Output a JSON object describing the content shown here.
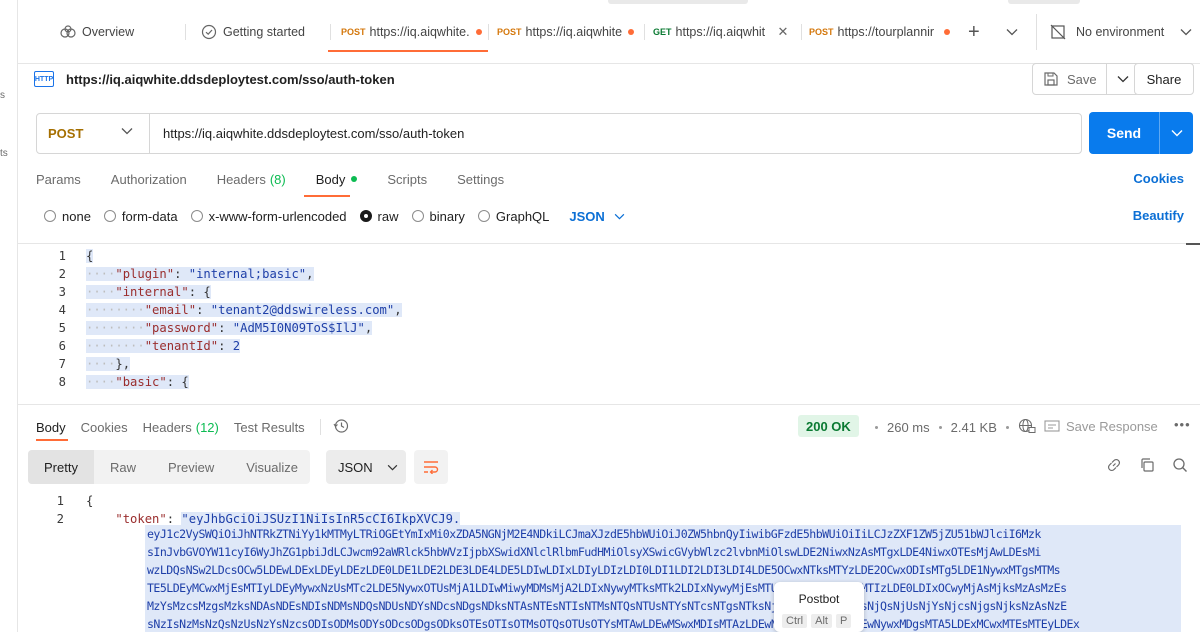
{
  "left_nav": {
    "items": [
      "s",
      "ts"
    ]
  },
  "tabs": [
    {
      "type": "home",
      "label": "Overview"
    },
    {
      "type": "home",
      "label": "Getting started"
    },
    {
      "type": "request",
      "method": "POST",
      "url": "https://iq.aiqwhite.",
      "unsaved": true,
      "method_color": "#d4770b"
    },
    {
      "type": "request",
      "method": "POST",
      "url": "https://iq.aiqwhite",
      "unsaved": true,
      "method_color": "#d4770b"
    },
    {
      "type": "request",
      "method": "GET",
      "url": "https://iq.aiqwhit",
      "unsaved": false,
      "method_color": "#0a7a32"
    },
    {
      "type": "request",
      "method": "POST",
      "url": "https://tourplannir",
      "unsaved": true,
      "method_color": "#d4770b"
    }
  ],
  "environment": "No environment",
  "request": {
    "title": "https://iq.aiqwhite.ddsdeploytest.com/sso/auth-token",
    "save_label": "Save",
    "share_label": "Share",
    "method": "POST",
    "url": "https://iq.aiqwhite.ddsdeploytest.com/sso/auth-token",
    "send_label": "Send",
    "subtabs": [
      {
        "label": "Params"
      },
      {
        "label": "Authorization"
      },
      {
        "label": "Headers",
        "count": "(8)"
      },
      {
        "label": "Body",
        "active": true
      },
      {
        "label": "Scripts"
      },
      {
        "label": "Settings"
      }
    ],
    "cookies_label": "Cookies",
    "body_modes": [
      "none",
      "form-data",
      "x-www-form-urlencoded",
      "raw",
      "binary",
      "GraphQL"
    ],
    "selected_mode": "raw",
    "format": "JSON",
    "beautify_label": "Beautify",
    "body_lines": [
      {
        "n": "1",
        "text": "{"
      },
      {
        "n": "2",
        "key": "\"plugin\"",
        "value": "\"internal;basic\"",
        "suffix": ","
      },
      {
        "n": "3",
        "key": "\"internal\"",
        "value": "{",
        "suffix": ""
      },
      {
        "n": "4",
        "key": "\"email\"",
        "value": "\"tenant2@ddswireless.com\"",
        "suffix": ","
      },
      {
        "n": "5",
        "key": "\"password\"",
        "value": "\"AdM5I0N09ToS$IlJ\"",
        "suffix": ","
      },
      {
        "n": "6",
        "key": "\"tenantId\"",
        "value": "2",
        "suffix": ""
      },
      {
        "n": "7",
        "text": "},"
      },
      {
        "n": "8",
        "key": "\"basic\"",
        "value": "{",
        "suffix": ""
      }
    ]
  },
  "response": {
    "tabs": [
      {
        "label": "Body",
        "active": true
      },
      {
        "label": "Cookies"
      },
      {
        "label": "Headers",
        "count": "(12)"
      },
      {
        "label": "Test Results"
      }
    ],
    "status": "200 OK",
    "time": "260 ms",
    "size": "2.41 KB",
    "save_response_label": "Save Response",
    "view_modes": [
      "Pretty",
      "Raw",
      "Preview",
      "Visualize"
    ],
    "format": "JSON",
    "line1": "{",
    "token_key": "\"token\"",
    "token_first": "\"eyJhbGciOiJSUzI1NiIsInR5cCI6IkpXVCJ9.",
    "token_lines": [
      "eyJ1c2VySWQiOiJhNTRkZTNiYy1kMTMyLTRiOGEtYmIxMi0xZDA5NGNjM2E4NDkiLCJmaXJzdE5hbWUiOiJ0ZW5hbnQyIiwibGFzdE5hbWUiOiIiLCJzZXF1ZW5jZU51bWJlciI6Mzk",
      "sInJvbGVOYW11cyI6WyJhZG1pbiJdLCJwcm92aWRlck5hbWVzIjpbXSwidXNlclRlbmFudHMiOlsyXSwicGVybWlzc2lvbnMiOlswLDE2NiwxNzAsMTgxLDE4NiwxOTEsMjAwLDEsMi",
      "wzLDQsNSw2LDcsOCw5LDEwLDExLDEyLDEzLDE0LDE1LDE2LDE3LDE4LDE5LDIwLDIxLDIyLDIzLDI0LDI1LDI2LDI3LDI4LDE5OCwxNTksMTYzLDE2OCwxODIsMTg5LDE1NywxMTgsMTMs",
      "TE5LDEyMCwxMjEsMTIyLDEyMywxNzUsMTc2LDE5NywxOTUsMjA1LDIwMiwyMDMsMjA2LDIxNywyMTksMTk2LDIxNywyMjEsMTU0LDE0NiwxMjIsMTIzLDE0LDIxOCwyMjAsMjksMzAsMzEs",
      "MzYsMzcsMzgsMzksNDAsNDEsNDIsNDMsNDQsNDUsNDYsNDcsNDgsNDksNTAsNTEsNTIsNTMsNTQsNTUsNTYsNTcsNTgsNTksNjAsNjEsNjIsNjMsNjQsNjUsNjYsNjcsNjgsNjksNzAsNzE",
      "sNzIsNzMsNzQsNzUsNzYsNzcsODIsODMsODYsODcsODgsODksOTEsOTIsOTMsOTQsOTUsOTYsMTAwLDEwMSwxMDIsMTAzLDEwNCwxMDUsMTA2LDEwNywxMDgsMTA5LDExMCwxMTEsMTEyLDEx"
    ]
  },
  "postbot": {
    "label": "Postbot",
    "keys": [
      "Ctrl",
      "Alt",
      "P"
    ]
  },
  "colors": {
    "accent": "#ff6c37",
    "send": "#097bed",
    "link": "#0b6fd5",
    "success": "#0cbb52"
  }
}
